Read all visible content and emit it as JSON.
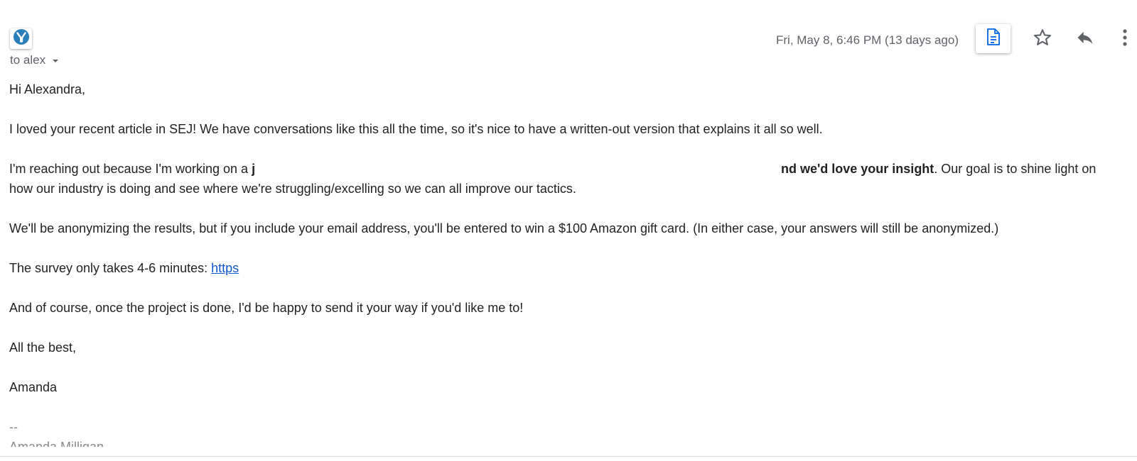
{
  "header": {
    "recipient": "to alex",
    "datetime": "Fri, May 8, 6:46 PM (13 days ago)"
  },
  "icons": {
    "avatar": "yoast-logo-icon",
    "document": "document-icon",
    "star": "star-icon",
    "reply": "reply-icon",
    "more": "more-vertical-icon"
  },
  "colors": {
    "accent_blue": "#1a73e8",
    "avatar_blue": "#2b7fb8",
    "icon_gray": "#5f6368",
    "link_blue": "#1155cc"
  },
  "message": {
    "greeting": "Hi Alexandra,",
    "paragraph1": "I loved your recent article in SEJ! We have conversations like this all the time, so it's nice to have a written-out version that explains it all so well.",
    "paragraph2_start": "I'm reaching out because I'm working on a ",
    "paragraph2_bold_start": "j",
    "paragraph2_bold_end": "nd we'd love your insight",
    "paragraph2_end": ". Our goal is to shine light on",
    "paragraph2_line2": "how our industry is doing and see where we're struggling/excelling so we can all improve our tactics.",
    "paragraph3": "We'll be anonymizing the results, but if you include your email address, you'll be entered to win a $100 Amazon gift card. (In either case, your answers will still be anonymized.)",
    "survey_text": "The survey only takes 4-6 minutes: ",
    "survey_link": "https",
    "paragraph5": "And of course, once the project is done, I'd be happy to send it your way if you'd like me to!",
    "closing": "All the best,",
    "sender": "Amanda",
    "signature_separator": "--",
    "signature_name": "Amanda Milligan"
  }
}
